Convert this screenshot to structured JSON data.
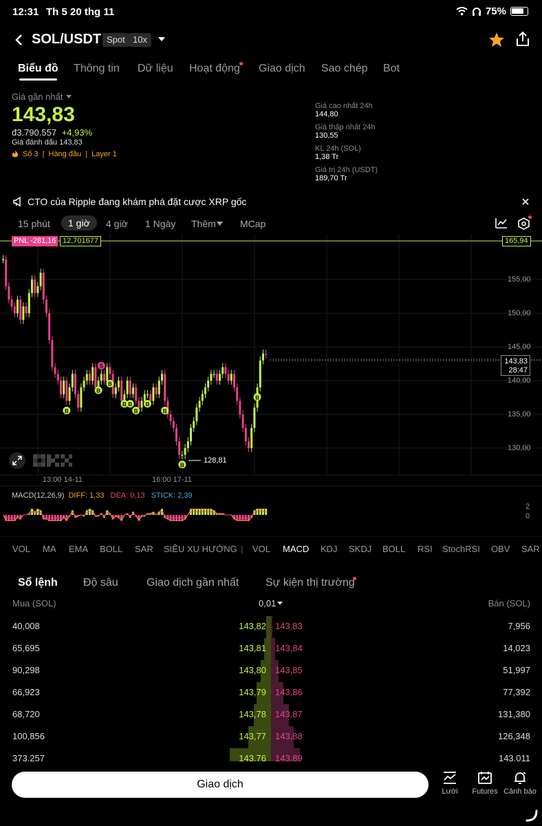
{
  "status_bar": {
    "time": "12:31",
    "date": "Th 5 20 thg 11",
    "battery": "75%"
  },
  "header": {
    "pair": "SOL/USDT",
    "market_type": "Spot",
    "leverage": "10x"
  },
  "tabs": [
    {
      "label": "Biểu đồ",
      "active": true
    },
    {
      "label": "Thông tin",
      "active": false
    },
    {
      "label": "Dữ liệu",
      "active": false
    },
    {
      "label": "Hoạt động",
      "active": false,
      "badge": true
    },
    {
      "label": "Giao dịch",
      "active": false
    },
    {
      "label": "Sao chép",
      "active": false
    },
    {
      "label": "Bot",
      "active": false
    }
  ],
  "price": {
    "label": "Giá gần nhất",
    "last": "143,83",
    "fiat": "đ3.790.557",
    "change": "+4,93%",
    "mark_label": "Giá đánh dấu 143,83",
    "tags": [
      "Số 3",
      "Hàng đầu",
      "Layer 1"
    ]
  },
  "stats": [
    {
      "label": "Giá cao nhất 24h",
      "value": "144,80"
    },
    {
      "label": "Giá thấp nhất 24h",
      "value": "130,55"
    },
    {
      "label": "KL 24h (SOL)",
      "value": "1,38 Tr"
    },
    {
      "label": "Giá trị 24h (USDT)",
      "value": "189,70 Tr"
    }
  ],
  "notice": {
    "text": "CTO của Ripple đang khám phá đặt cược XRP gốc"
  },
  "intervals": [
    "15 phút",
    "1 giờ",
    "4 giờ",
    "1 Ngày",
    "Thêm",
    "MCap"
  ],
  "chart": {
    "pnl_label": "PNL -281,16",
    "pnl_amount": "12,701677",
    "pnl_price": "165,94",
    "current_price": "143,83",
    "countdown": "28:47",
    "low_label": "128,81",
    "y_ticks": [
      "155,00",
      "150,00",
      "145,00",
      "140,00",
      "135,00",
      "130,00"
    ],
    "x_ticks": [
      "13:00 14-11",
      "16:00 17-11"
    ],
    "macd_label": "MACD(12,26,9)",
    "diff": "DIFF: 1,33",
    "dea": "DEA: 0,13",
    "stick": "STICK: 2,39",
    "macd_ticks": [
      "2",
      "0"
    ],
    "colors": {
      "up": "#c4f04a",
      "down": "#e8418a",
      "pnl": "#c4f04a",
      "buy_marker": "#c4f04a",
      "sell_marker": "#e8418a"
    }
  },
  "chart_data": {
    "type": "candlestick",
    "price_points": [
      158,
      154,
      152,
      151,
      150,
      152,
      149,
      151,
      150,
      153,
      155,
      153,
      154,
      156,
      152,
      150,
      146,
      142,
      141,
      140,
      138,
      140,
      137,
      139,
      141,
      138,
      136,
      139,
      140,
      141,
      140,
      142,
      139,
      140,
      141,
      140,
      142,
      141,
      138,
      139,
      140,
      137,
      138,
      140,
      138,
      139,
      137,
      136,
      137,
      138,
      138,
      137,
      139,
      138,
      140,
      141,
      137,
      135,
      134,
      133,
      131,
      129,
      129,
      130,
      131,
      133,
      134,
      136,
      137,
      138,
      139,
      140,
      141,
      141,
      140,
      141,
      142,
      141,
      140,
      141,
      139,
      137,
      135,
      133,
      131,
      130,
      133,
      136,
      139,
      143,
      144,
      143.83
    ],
    "markers": [
      "B",
      "B",
      "S",
      "B",
      "B",
      "B",
      "B",
      "B",
      "B",
      "B",
      "B"
    ],
    "low": "128,81",
    "ylim": [
      128,
      158
    ]
  },
  "indicators_left": [
    "VOL",
    "MA",
    "EMA",
    "BOLL",
    "SAR",
    "SIÊU XU HƯỚNG"
  ],
  "indicators_right": [
    "VOL",
    "MACD",
    "KDJ",
    "SKDJ",
    "BOLL",
    "RSI",
    "StochRSI",
    "OBV",
    "SAR"
  ],
  "orderbook": {
    "tabs": [
      "Sổ lệnh",
      "Độ sâu",
      "Giao dịch gần nhất",
      "Sự kiện thị trường"
    ],
    "buy_header": "Mua (SOL)",
    "tick": "0,01",
    "sell_header": "Bán (SOL)",
    "rows": [
      {
        "bq": "40,008",
        "bp": "143,82",
        "ap": "143,83",
        "aq": "7,956",
        "bd": 0.05,
        "ad": 0.02
      },
      {
        "bq": "65,695",
        "bp": "143,81",
        "ap": "143,84",
        "aq": "14,023",
        "bd": 0.07,
        "ad": 0.05
      },
      {
        "bq": "90,298",
        "bp": "143,80",
        "ap": "143,85",
        "aq": "51,997",
        "bd": 0.1,
        "ad": 0.1
      },
      {
        "bq": "66,923",
        "bp": "143,79",
        "ap": "143,86",
        "aq": "77,392",
        "bd": 0.14,
        "ad": 0.16
      },
      {
        "bq": "68,720",
        "bp": "143,78",
        "ap": "143,87",
        "aq": "131,380",
        "bd": 0.17,
        "ad": 0.24
      },
      {
        "bq": "100,856",
        "bp": "143,77",
        "ap": "143,88",
        "aq": "126,348",
        "bd": 0.22,
        "ad": 0.3
      },
      {
        "bq": "373,257",
        "bp": "143,76",
        "ap": "143,89",
        "aq": "143,011",
        "bd": 0.4,
        "ad": 0.38
      }
    ]
  },
  "bottom": {
    "trade_label": "Giao dịch",
    "icons": [
      {
        "name": "grid",
        "label": "Lưới"
      },
      {
        "name": "futures",
        "label": "Futures"
      },
      {
        "name": "alert",
        "label": "Cảnh báo"
      }
    ]
  }
}
